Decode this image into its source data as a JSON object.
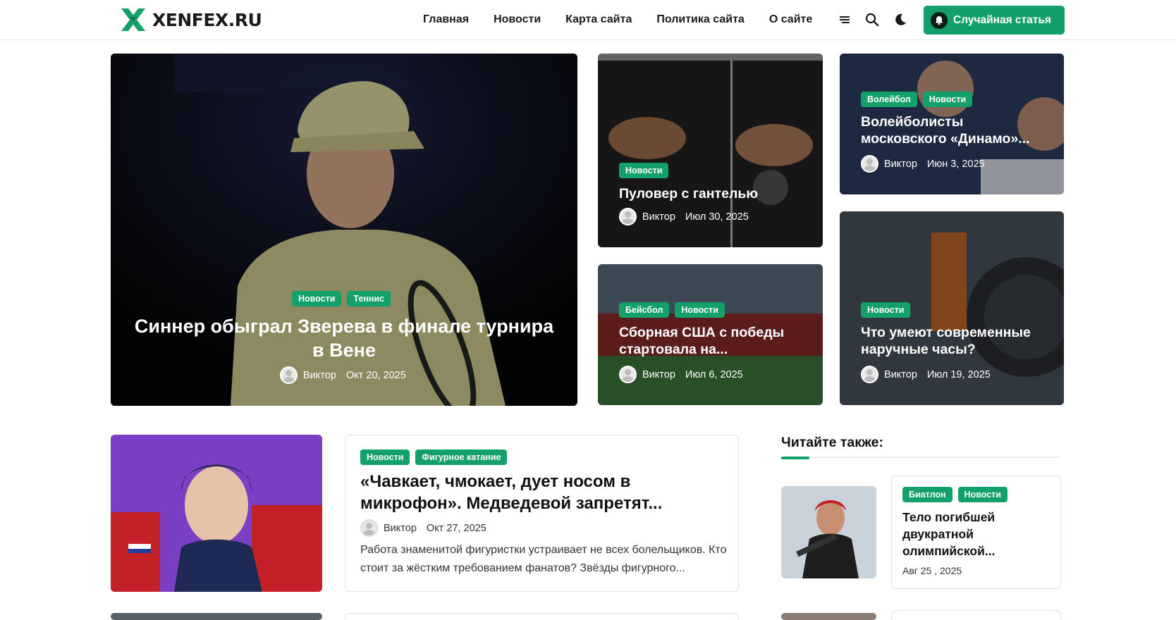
{
  "site": {
    "logo_text": "XENFEX.RU",
    "brand_color": "#14a06a"
  },
  "nav": {
    "items": [
      "Главная",
      "Новости",
      "Карта сайта",
      "Политика сайта",
      "О сайте"
    ]
  },
  "header_icons": [
    "menu-icon",
    "search-icon",
    "moon-icon"
  ],
  "random_button": {
    "label": "Случайная статья",
    "icon": "bell-icon"
  },
  "featured": {
    "main": {
      "tags": [
        "Новости",
        "Теннис"
      ],
      "title": "Синнер обыграл Зверева в финале турнира в Вене",
      "author": "Виктор",
      "date": "Окт 20, 2025"
    },
    "card2": {
      "tags": [
        "Новости"
      ],
      "title": "Пуловер с гантелью",
      "author": "Виктор",
      "date": "Июл 30, 2025"
    },
    "card3": {
      "tags": [
        "Волейбол",
        "Новости"
      ],
      "title": "Волейболисты московского «Динамо»...",
      "author": "Виктор",
      "date": "Июн 3, 2025"
    },
    "card4": {
      "tags": [
        "Бейсбол",
        "Новости"
      ],
      "title": "Сборная США с победы стартовала на...",
      "author": "Виктор",
      "date": "Июл 6, 2025"
    },
    "card5": {
      "tags": [
        "Новости"
      ],
      "title": "Что умеют современные наручные часы?",
      "author": "Виктор",
      "date": "Июл 19, 2025"
    }
  },
  "article": {
    "tags": [
      "Новости",
      "Фигурное катание"
    ],
    "title": "«Чавкает, чмокает, дует носом в микрофон». Медведевой запретят...",
    "author": "Виктор",
    "date": "Окт 27, 2025",
    "excerpt": "Работа знаменитой фигуристки устраивает не всех болельщиков. Кто стоит за жёстким требованием фанатов? Звёзды фигурного..."
  },
  "sidebar": {
    "heading": "Читайте также:",
    "items": [
      {
        "tags": [
          "Биатлон",
          "Новости"
        ],
        "title": "Тело погибшей двукратной олимпийской...",
        "date": "Авг 25 , 2025"
      }
    ]
  }
}
